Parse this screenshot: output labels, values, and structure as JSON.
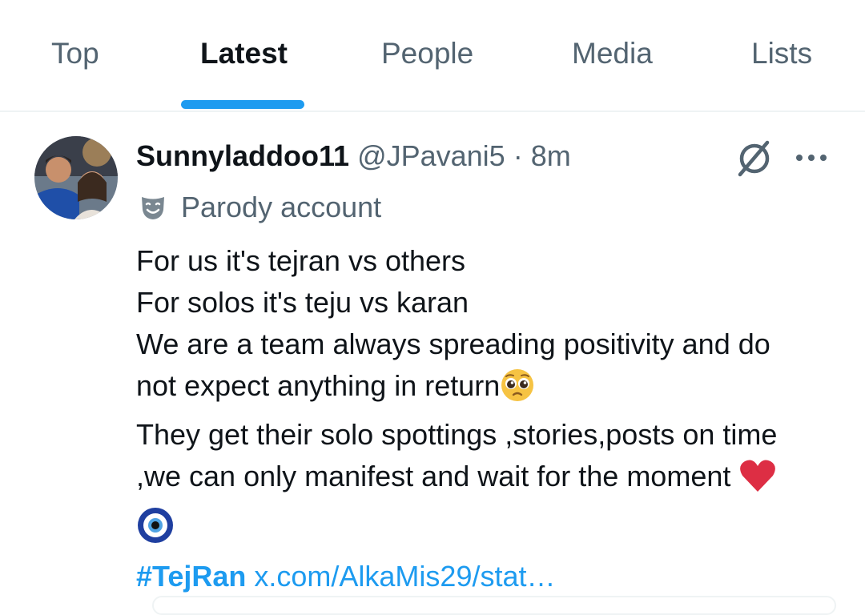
{
  "tabs": [
    {
      "label": "Top",
      "active": false
    },
    {
      "label": "Latest",
      "active": true
    },
    {
      "label": "People",
      "active": false
    },
    {
      "label": "Media",
      "active": false
    },
    {
      "label": "Lists",
      "active": false
    }
  ],
  "tweet": {
    "display_name": "Sunnyladdoo11",
    "handle": "@JPavani5",
    "separator": "·",
    "time": "8m",
    "account_label": "Parody account",
    "lines": [
      "For us it's tejran vs others",
      "For solos it's teju vs karan",
      "We are a team always spreading  positivity and do",
      "not expect anything in return",
      "They get their solo spottings ,stories,posts on time",
      ",we can only manifest and wait for the moment "
    ],
    "hashtag": "#TejRan",
    "link_text": "x.com/AlkaMis29/stat…"
  },
  "icons": {
    "grok": "grok-icon",
    "more": "more-icon",
    "parody": "theater-mask-icon",
    "emoji_pleading": "pleading-face-emoji",
    "emoji_heart": "red-heart-emoji",
    "emoji_nazar": "nazar-amulet-emoji"
  },
  "colors": {
    "accent": "#1d9bf0",
    "secondary_text": "#536471",
    "primary_text": "#0f1419",
    "divider": "#eff3f4"
  }
}
